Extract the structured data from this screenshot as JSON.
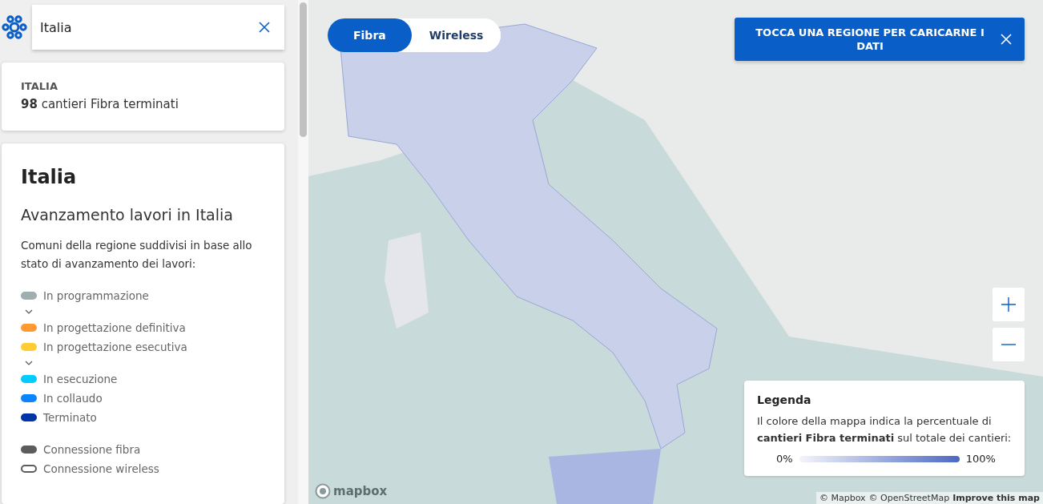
{
  "search": {
    "value": "Italia"
  },
  "summary": {
    "region": "ITALIA",
    "text": "**98** cantieri Fibra terminati"
  },
  "details": {
    "title": "Italia",
    "subtitle": "Avanzamento lavori in Italia",
    "description": "Comuni della regione suddivisi in base allo stato di avanzamento dei lavori:",
    "legend": [
      {
        "kind": "swatch",
        "label": "In programmazione",
        "color": "#9eaeb1"
      },
      {
        "kind": "chevron"
      },
      {
        "kind": "swatch",
        "label": "In progettazione definitiva",
        "color": "#ff9a33"
      },
      {
        "kind": "swatch",
        "label": "In progettazione esecutiva",
        "color": "#ffcc33"
      },
      {
        "kind": "chevron"
      },
      {
        "kind": "swatch",
        "label": "In esecuzione",
        "color": "#00ccff"
      },
      {
        "kind": "swatch",
        "label": "In collaudo",
        "color": "#0a84ff"
      },
      {
        "kind": "swatch",
        "label": "Terminato",
        "color": "#0033a6"
      },
      {
        "kind": "gap"
      },
      {
        "kind": "swatch",
        "label": "Connessione fibra",
        "color": "#5c5c5c"
      },
      {
        "kind": "outline",
        "label": "Connessione wireless",
        "color": "#5c5c5c"
      }
    ]
  },
  "map": {
    "tabs": [
      {
        "label": "Fibra",
        "selected": true
      },
      {
        "label": "Wireless",
        "selected": false
      }
    ],
    "banner": {
      "text": "TOCCA UNA REGIONE PER CARICARNE I DATI"
    },
    "legend": {
      "title": "Legenda",
      "text": "Il colore della mappa indica la percentuale di **cantieri Fibra terminati** sul totale dei cantieri:",
      "min": "0%",
      "max": "100%"
    },
    "logo": "mapbox",
    "attribution": [
      "© Mapbox",
      "© OpenStreetMap"
    ],
    "improve_link": "Improve this map"
  }
}
